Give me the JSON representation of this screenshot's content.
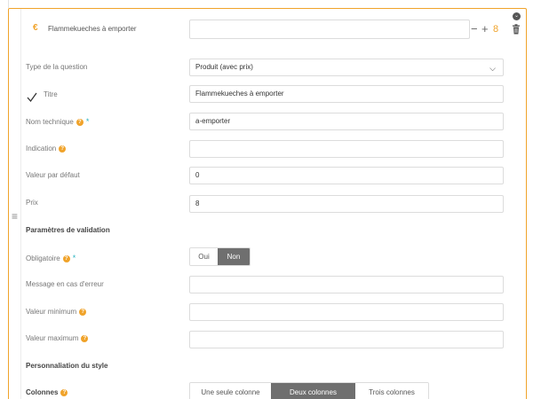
{
  "header": {
    "euro": "€",
    "title": "Flammekueches à emporter",
    "minus": "−",
    "plus": "+",
    "count": "8"
  },
  "fields": {
    "type_label": "Type de la question",
    "type_value": "Produit (avec prix)",
    "titre_label": "Titre",
    "titre_value": "Flammekueches à emporter",
    "nom_label": "Nom technique",
    "nom_value": "a-emporter",
    "indication_label": "Indication",
    "indication_value": "",
    "defaut_label": "Valeur par défaut",
    "defaut_value": "0",
    "prix_label": "Prix",
    "prix_value": "8"
  },
  "validation": {
    "section_title": "Paramètres de validation",
    "obligatoire_label": "Obligatoire",
    "oui": "Oui",
    "non": "Non",
    "selected": "Non",
    "message_label": "Message en cas d'erreur",
    "message_value": "",
    "min_label": "Valeur minimum",
    "min_value": "",
    "max_label": "Valeur maximum",
    "max_value": ""
  },
  "style": {
    "section_title": "Personnaliation du style",
    "colonnes_label": "Colonnes",
    "options": [
      "Une seule colonne",
      "Deux colonnes",
      "Trois colonnes"
    ],
    "selected": "Deux colonnes"
  },
  "colors": {
    "accent": "#f0a32a",
    "required": "#2bb3c0",
    "selected_segment": "#6f6f6f"
  },
  "icons": [
    "euro-icon",
    "chevron-down-icon",
    "trash-icon",
    "checkmark-icon",
    "question-icon",
    "drag-handle-icon"
  ]
}
